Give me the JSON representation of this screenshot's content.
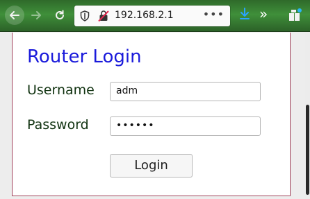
{
  "browser": {
    "url": "192.168.2.1",
    "more_label": "•••",
    "overflow_label": "»"
  },
  "form": {
    "title": "Router Login",
    "username_label": "Username",
    "username_value": "adm",
    "password_label": "Password",
    "password_mask": "••••••",
    "login_label": "Login"
  },
  "colors": {
    "title": "#1a1adb",
    "card_border": "#a0405a",
    "toolbar": "#3f8f3a"
  }
}
